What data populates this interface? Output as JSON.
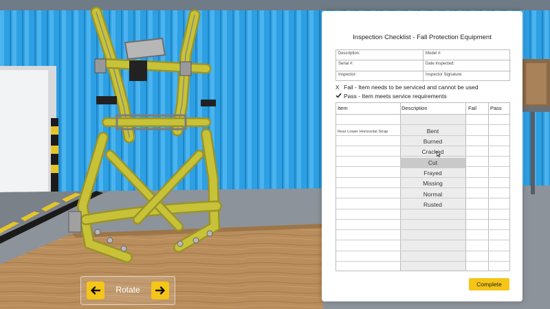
{
  "checklist_panel": {
    "title": "Inspection Checklist - Fall Protection Equipment",
    "info_fields": {
      "description": "Description:",
      "model": "Model #:",
      "serial": "Serial #:",
      "date_inspected": "Date Inspected:",
      "inspector": "Inspector:",
      "inspector_signature": "Inspector Signature:"
    },
    "legend": {
      "fail_mark": "X",
      "fail_text": "Fail - Item needs to be serviced and cannot be used",
      "pass_text": "Pass - Item meets service requirements"
    },
    "columns": [
      "Item",
      "Description",
      "Fail",
      "Pass"
    ],
    "current_item": "Rear Lower Horizontal Strap",
    "description_options": [
      "Bent",
      "Burned",
      "Cracked",
      "Cut",
      "Frayed",
      "Missing",
      "Normal",
      "Rusted"
    ],
    "selected_option": "Cut",
    "complete_label": "Complete"
  },
  "rotate_control": {
    "label": "Rotate"
  },
  "colors": {
    "accent": "#f5c518",
    "wall": "#2f9ee0",
    "harness": "#c8c238"
  }
}
